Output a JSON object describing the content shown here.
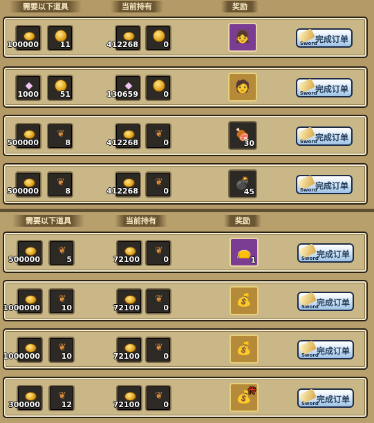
{
  "panels": [
    {
      "headers": {
        "required": "需要以下道具",
        "current": "当前持有",
        "reward": "奖励"
      },
      "rows": [
        {
          "req": [
            {
              "icon": "gold-coin",
              "count": "100000"
            },
            {
              "icon": "coin",
              "count": "11"
            }
          ],
          "have": [
            {
              "icon": "gold-coin",
              "count": "412268"
            },
            {
              "icon": "coin",
              "count": "0"
            }
          ],
          "reward": {
            "icon": "girl-portrait",
            "count": "",
            "frame": "purple"
          },
          "button": {
            "label": "完成订单",
            "sub": "Sword"
          }
        },
        {
          "req": [
            {
              "icon": "gem",
              "count": "1000"
            },
            {
              "icon": "coin",
              "count": "51"
            }
          ],
          "have": [
            {
              "icon": "gem",
              "count": "130659"
            },
            {
              "icon": "coin",
              "count": "0"
            }
          ],
          "reward": {
            "icon": "boy-portrait",
            "count": "",
            "frame": "gold"
          },
          "button": {
            "label": "完成订单",
            "sub": "Sword"
          }
        },
        {
          "req": [
            {
              "icon": "gold-coin",
              "count": "500000"
            },
            {
              "icon": "wings",
              "count": "8"
            }
          ],
          "have": [
            {
              "icon": "gold-coin",
              "count": "412268"
            },
            {
              "icon": "wings",
              "count": "0"
            }
          ],
          "reward": {
            "icon": "meat-bag",
            "count": "30",
            "frame": "dark"
          },
          "button": {
            "label": "完成订单",
            "sub": "Sword"
          }
        },
        {
          "req": [
            {
              "icon": "gold-coin",
              "count": "500000"
            },
            {
              "icon": "wings",
              "count": "8"
            }
          ],
          "have": [
            {
              "icon": "gold-coin",
              "count": "412268"
            },
            {
              "icon": "wings",
              "count": "0"
            }
          ],
          "reward": {
            "icon": "bomb",
            "count": "45",
            "frame": "dark"
          },
          "button": {
            "label": "完成订单",
            "sub": "Sword"
          }
        }
      ]
    },
    {
      "headers": {
        "required": "需要以下道具",
        "current": "当前持有",
        "reward": "奖励"
      },
      "rows": [
        {
          "req": [
            {
              "icon": "gold-coin",
              "count": "500000"
            },
            {
              "icon": "wings",
              "count": "5"
            }
          ],
          "have": [
            {
              "icon": "gold-coin",
              "count": "72100"
            },
            {
              "icon": "wings",
              "count": "0"
            }
          ],
          "reward": {
            "icon": "purple-bag",
            "count": "1",
            "frame": "purple"
          },
          "button": {
            "label": "完成订单",
            "sub": "Sword"
          }
        },
        {
          "req": [
            {
              "icon": "gold-coin",
              "count": "1000000"
            },
            {
              "icon": "wings",
              "count": "10"
            }
          ],
          "have": [
            {
              "icon": "gold-coin",
              "count": "72100"
            },
            {
              "icon": "wings",
              "count": "0"
            }
          ],
          "reward": {
            "icon": "gold-bag",
            "count": "",
            "frame": "gold"
          },
          "button": {
            "label": "完成订单",
            "sub": "Sword"
          }
        },
        {
          "req": [
            {
              "icon": "gold-coin",
              "count": "1000000"
            },
            {
              "icon": "wings",
              "count": "10"
            }
          ],
          "have": [
            {
              "icon": "gold-coin",
              "count": "72100"
            },
            {
              "icon": "wings",
              "count": "0"
            }
          ],
          "reward": {
            "icon": "gold-bag",
            "count": "",
            "frame": "gold"
          },
          "button": {
            "label": "完成订单",
            "sub": "Sword"
          }
        },
        {
          "req": [
            {
              "icon": "gold-coin",
              "count": "300000"
            },
            {
              "icon": "wings",
              "count": "12"
            }
          ],
          "have": [
            {
              "icon": "gold-coin",
              "count": "72100"
            },
            {
              "icon": "wings",
              "count": "0"
            }
          ],
          "reward": {
            "icon": "legend-bag",
            "count": "",
            "frame": "gold",
            "tag": "传"
          },
          "button": {
            "label": "完成订单",
            "sub": "Sword"
          }
        }
      ]
    }
  ]
}
